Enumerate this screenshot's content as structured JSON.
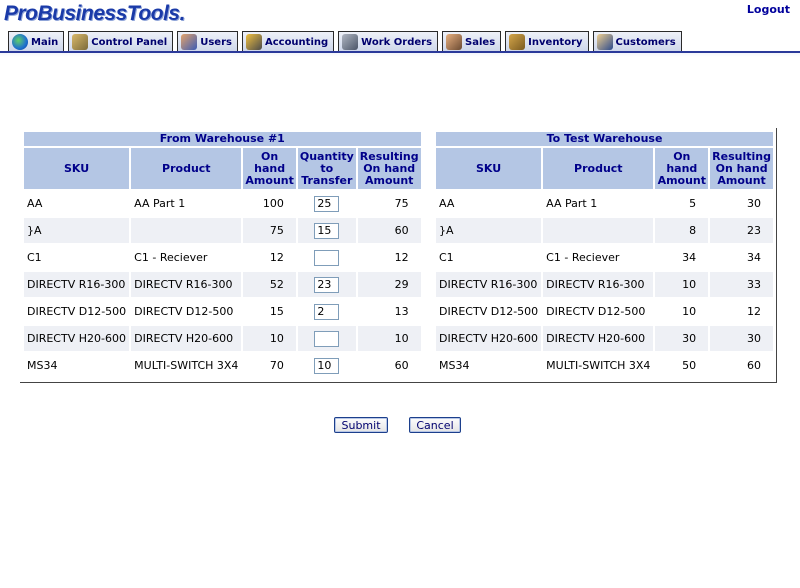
{
  "header": {
    "logo_text": "ProBusinessTools.",
    "logout_label": "Logout"
  },
  "tabs": [
    {
      "label": "Main",
      "icon": "globe-icon"
    },
    {
      "label": "Control Panel",
      "icon": "wrench-icon"
    },
    {
      "label": "Users",
      "icon": "users-icon"
    },
    {
      "label": "Accounting",
      "icon": "accountant-icon"
    },
    {
      "label": "Work Orders",
      "icon": "truck-icon"
    },
    {
      "label": "Sales",
      "icon": "salesperson-icon"
    },
    {
      "label": "Inventory",
      "icon": "inventory-icon"
    },
    {
      "label": "Customers",
      "icon": "customers-icon"
    }
  ],
  "from_warehouse": {
    "title": "From Warehouse #1",
    "headers": {
      "sku": "SKU",
      "product": "Product",
      "on_hand": "On hand Amount",
      "qty": "Quantity to Transfer",
      "result": "Resulting On hand Amount"
    },
    "rows": [
      {
        "sku": "AA",
        "product": "AA Part 1",
        "on_hand": "100",
        "qty": "25",
        "result": "75"
      },
      {
        "sku": "}A",
        "product": "",
        "on_hand": "75",
        "qty": "15",
        "result": "60"
      },
      {
        "sku": "C1",
        "product": "C1 - Reciever",
        "on_hand": "12",
        "qty": "",
        "result": "12"
      },
      {
        "sku": "DIRECTV R16-300",
        "product": "DIRECTV R16-300",
        "on_hand": "52",
        "qty": "23",
        "result": "29"
      },
      {
        "sku": "DIRECTV D12-500",
        "product": "DIRECTV D12-500",
        "on_hand": "15",
        "qty": "2",
        "result": "13"
      },
      {
        "sku": "DIRECTV H20-600",
        "product": "DIRECTV H20-600",
        "on_hand": "10",
        "qty": "",
        "result": "10"
      },
      {
        "sku": "MS34",
        "product": "MULTI-SWITCH 3X4",
        "on_hand": "70",
        "qty": "10",
        "result": "60"
      }
    ]
  },
  "to_warehouse": {
    "title": "To Test Warehouse",
    "headers": {
      "sku": "SKU",
      "product": "Product",
      "on_hand": "On hand Amount",
      "result": "Resulting On hand Amount"
    },
    "rows": [
      {
        "sku": "AA",
        "product": "AA Part 1",
        "on_hand": "5",
        "result": "30"
      },
      {
        "sku": "}A",
        "product": "",
        "on_hand": "8",
        "result": "23"
      },
      {
        "sku": "C1",
        "product": "C1 - Reciever",
        "on_hand": "34",
        "result": "34"
      },
      {
        "sku": "DIRECTV R16-300",
        "product": "DIRECTV R16-300",
        "on_hand": "10",
        "result": "33"
      },
      {
        "sku": "DIRECTV D12-500",
        "product": "DIRECTV D12-500",
        "on_hand": "10",
        "result": "12"
      },
      {
        "sku": "DIRECTV H20-600",
        "product": "DIRECTV H20-600",
        "on_hand": "30",
        "result": "30"
      },
      {
        "sku": "MS34",
        "product": "MULTI-SWITCH 3X4",
        "on_hand": "50",
        "result": "60"
      }
    ]
  },
  "actions": {
    "submit_label": "Submit",
    "cancel_label": "Cancel"
  },
  "colors": {
    "header_bg": "#b4c6e4",
    "header_text": "#00008a",
    "tab_line": "#2b3a9a",
    "logo": "#1a3aa8",
    "alt_row": "#eef0f5"
  }
}
